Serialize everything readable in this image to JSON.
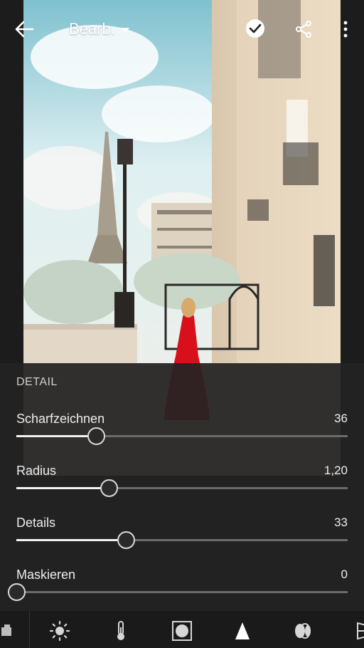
{
  "header": {
    "back_icon": "arrow-left-icon",
    "title": "Bearb.",
    "dropdown_icon": "caret-down-icon",
    "confirm_icon": "checkmark-circle-icon",
    "share_icon": "share-icon",
    "more_icon": "more-vertical-icon"
  },
  "panel": {
    "title": "DETAIL",
    "sliders": [
      {
        "label": "Scharfzeichnen",
        "value": "36",
        "fraction": 0.24
      },
      {
        "label": "Radius",
        "value": "1,20",
        "fraction": 0.28
      },
      {
        "label": "Details",
        "value": "33",
        "fraction": 0.33
      },
      {
        "label": "Maskieren",
        "value": "0",
        "fraction": 0.0
      }
    ]
  },
  "toolbar": {
    "tools": [
      {
        "icon": "presets-icon"
      },
      {
        "icon": "light-icon"
      },
      {
        "icon": "color-temperature-icon"
      },
      {
        "icon": "vignette-icon"
      },
      {
        "icon": "detail-icon",
        "active": true
      },
      {
        "icon": "optics-icon"
      },
      {
        "icon": "geometry-icon"
      }
    ]
  },
  "colors": {
    "accent": "#2f86ff",
    "panel_bg": "#222222",
    "track": "#6b6b6b",
    "track_fill": "#f2f2f2"
  }
}
